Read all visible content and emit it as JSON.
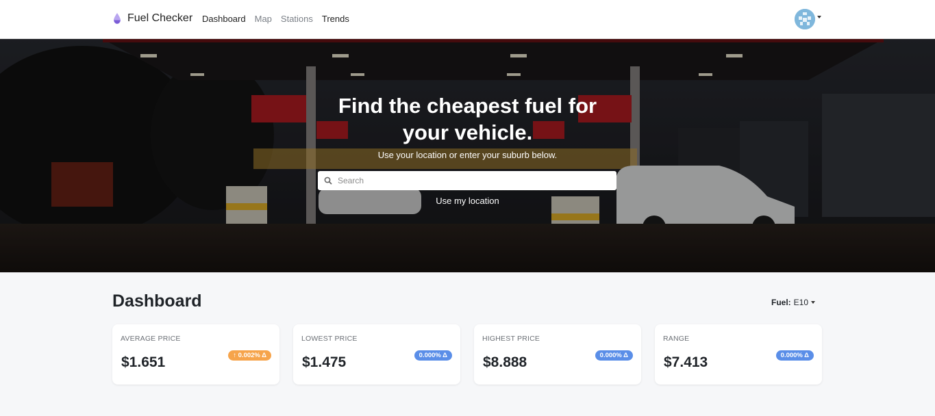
{
  "brand": {
    "name": "Fuel Checker",
    "icon": "droplet-icon",
    "icon_color": "#7b5cd6"
  },
  "nav": {
    "links": [
      {
        "label": "Dashboard"
      },
      {
        "label": "Map"
      },
      {
        "label": "Stations"
      },
      {
        "label": "Trends"
      }
    ]
  },
  "hero": {
    "title_line1": "Find the cheapest fuel for",
    "title_line2": "your vehicle.",
    "subtitle": "Use your location or enter your suburb below.",
    "search_placeholder": "Search",
    "search_value": "",
    "use_location": "Use my location"
  },
  "dashboard": {
    "title": "Dashboard",
    "fuel_label": "Fuel:",
    "fuel_value": "E10",
    "cards": [
      {
        "label": "AVERAGE PRICE",
        "value": "$1.651",
        "badge": "↑ 0.002% Δ",
        "badge_color": "#f6a44b"
      },
      {
        "label": "LOWEST PRICE",
        "value": "$1.475",
        "badge": "0.000% Δ",
        "badge_color": "#5a8ee8"
      },
      {
        "label": "HIGHEST PRICE",
        "value": "$8.888",
        "badge": "0.000% Δ",
        "badge_color": "#5a8ee8"
      },
      {
        "label": "RANGE",
        "value": "$7.413",
        "badge": "0.000% Δ",
        "badge_color": "#5a8ee8"
      }
    ]
  }
}
